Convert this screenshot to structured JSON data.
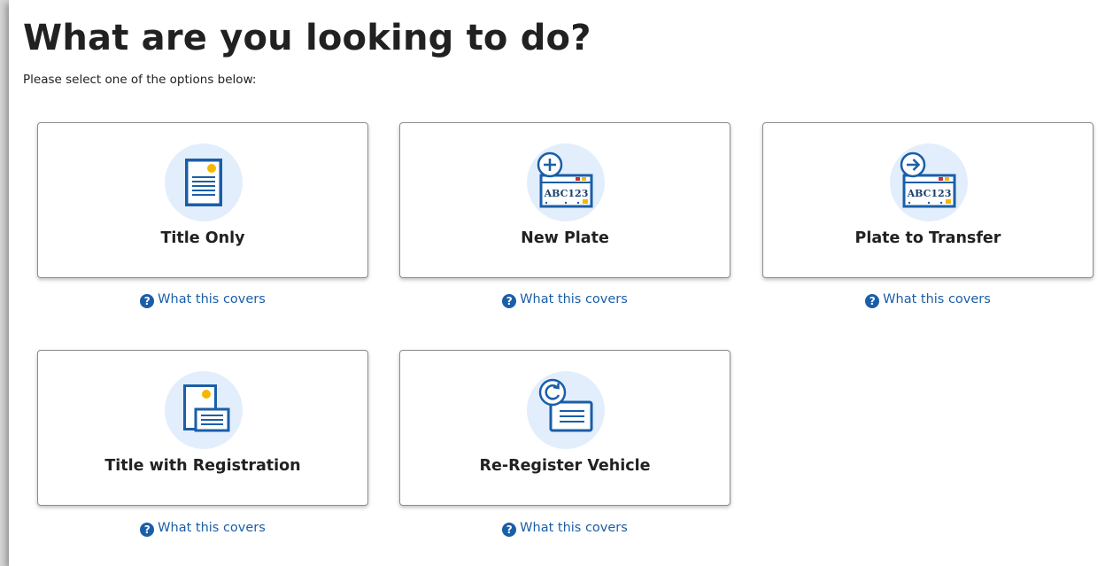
{
  "page": {
    "title": "What are you looking to do?",
    "subtitle": "Please select one of the options below:"
  },
  "options": [
    {
      "label": "Title Only",
      "icon": "title-document-icon",
      "help": "What this covers"
    },
    {
      "label": "New Plate",
      "icon": "new-plate-icon",
      "help": "What this covers",
      "plate_text": "ABC123"
    },
    {
      "label": "Plate to Transfer",
      "icon": "transfer-plate-icon",
      "help": "What this covers",
      "plate_text": "ABC123"
    },
    {
      "label": "Title with Registration",
      "icon": "title-registration-icon",
      "help": "What this covers"
    },
    {
      "label": "Re-Register Vehicle",
      "icon": "re-register-icon",
      "help": "What this covers"
    }
  ],
  "colors": {
    "icon_stroke": "#1a5ea8",
    "icon_circle_bg": "#e3eefc",
    "accent_yellow": "#f5b800",
    "accent_red": "#c9302c",
    "link": "#1a5ea8"
  },
  "help_icon": "question-circle-icon"
}
